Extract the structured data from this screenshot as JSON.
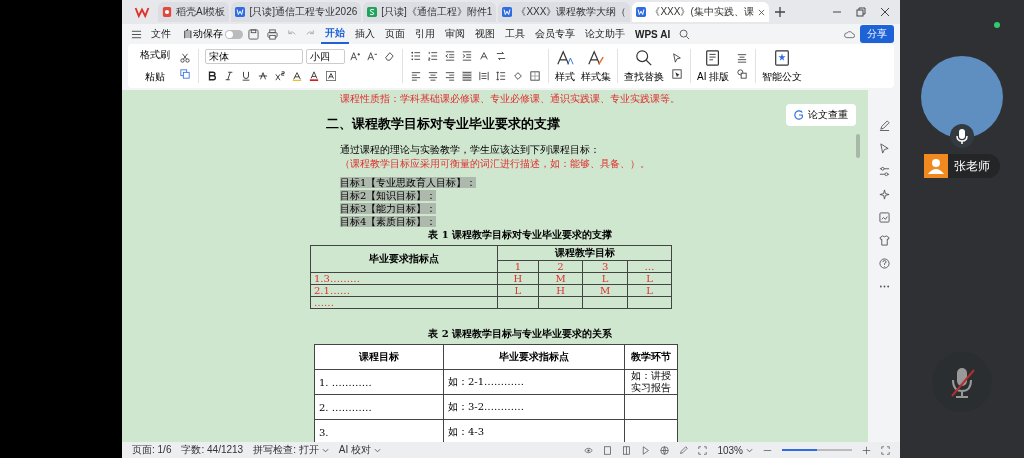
{
  "tabs": [
    {
      "label": "稻壳AI模板",
      "kind": "docer",
      "selected": false
    },
    {
      "label": "[只读]通信工程专业2026",
      "kind": "writer",
      "selected": false
    },
    {
      "label": "[只读]《通信工程》附件1",
      "kind": "sheet",
      "selected": false
    },
    {
      "label": "《XXX》课程教学大纲（",
      "kind": "writer",
      "selected": false
    },
    {
      "label": "《XXX》(集中实践、课",
      "kind": "writer",
      "selected": true
    }
  ],
  "menu": {
    "file": "文件",
    "autosave": {
      "label": "自动保存",
      "on": false
    },
    "items": [
      {
        "label": "开始",
        "selected": true
      },
      {
        "label": "插入",
        "selected": false
      },
      {
        "label": "页面",
        "selected": false
      },
      {
        "label": "引用",
        "selected": false
      },
      {
        "label": "审阅",
        "selected": false
      },
      {
        "label": "视图",
        "selected": false
      },
      {
        "label": "工具",
        "selected": false
      },
      {
        "label": "会员专享",
        "selected": false
      },
      {
        "label": "论文助手",
        "selected": false
      }
    ],
    "ai": "WPS AI",
    "share": "分享"
  },
  "ribbon": {
    "format_painter": "格式刷",
    "paste": "粘贴",
    "font": "宋体",
    "size": "小四",
    "style": "样式",
    "style_set": "样式集",
    "find": "查找替换",
    "ai_layout": "AI 排版",
    "smart_doc": "智能公文"
  },
  "document": {
    "red_note": "课程性质指：学科基础课必修课、专业必修课、通识实践课、专业实践课等。",
    "heading": "二、课程教学目标对专业毕业要求的支撑",
    "intro": "通过课程的理论与实验教学，学生应该达到下列课程目标：",
    "hint": "（课程教学目标应采用可衡量的词汇进行描述，如：能够、具备、）。",
    "goals": [
      "目标1【专业思政育人目标】：",
      "目标2【知识目标】：",
      "目标3【能力目标】：",
      "目标4【素质目标】："
    ],
    "table1": {
      "caption": "表 1 课程教学目标对专业毕业要求的支撑",
      "col_main": "毕业要求指标点",
      "col_group": "课程教学目标",
      "subcols": [
        "1",
        "2",
        "3",
        "…"
      ],
      "rows": [
        {
          "label": "1.3………",
          "cells": [
            "H",
            "M",
            "L",
            "L"
          ]
        },
        {
          "label": "2.1……",
          "cells": [
            "L",
            "H",
            "M",
            "L"
          ]
        },
        {
          "label": "……",
          "cells": [
            "",
            "",
            "",
            ""
          ]
        }
      ]
    },
    "table2": {
      "caption": "表 2 课程教学目标与专业毕业要求的关系",
      "columns": [
        "课程目标",
        "毕业要求指标点",
        "教学环节"
      ],
      "rows": [
        [
          "1. …………",
          "如：2-1…………",
          "如：讲授实习报告"
        ],
        [
          "2. …………",
          "如：3-2…………",
          ""
        ],
        [
          "3.",
          "如：4-3",
          ""
        ]
      ]
    },
    "check_button": "论文查重"
  },
  "status": {
    "page": "页面: 1/6",
    "words": "字数: 44/1213",
    "spell": "拼写检查: 打开",
    "ai_check": "AI 校对",
    "zoom": "103%",
    "zoom_level": {
      "level": 0.5
    }
  },
  "call": {
    "name": "张老师"
  }
}
